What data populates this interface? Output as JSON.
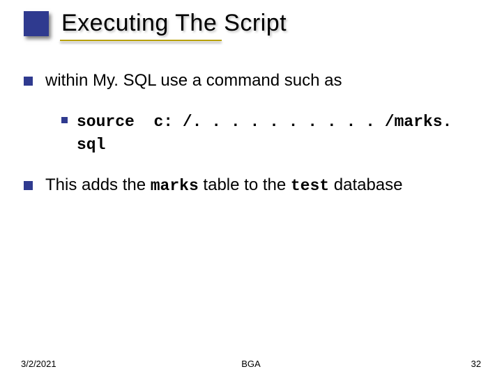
{
  "title": "Executing The Script",
  "bullet1": "within My. SQL use a command such as",
  "sub_cmd": "source",
  "sub_path": "c: /. . . . . . . . . . /marks. sql",
  "bullet2_pre": "This adds the ",
  "bullet2_code1": "marks",
  "bullet2_mid": " table to the ",
  "bullet2_code2": "test",
  "bullet2_post": " database",
  "footer_date": "3/2/2021",
  "footer_center": "BGA",
  "footer_num": "32"
}
